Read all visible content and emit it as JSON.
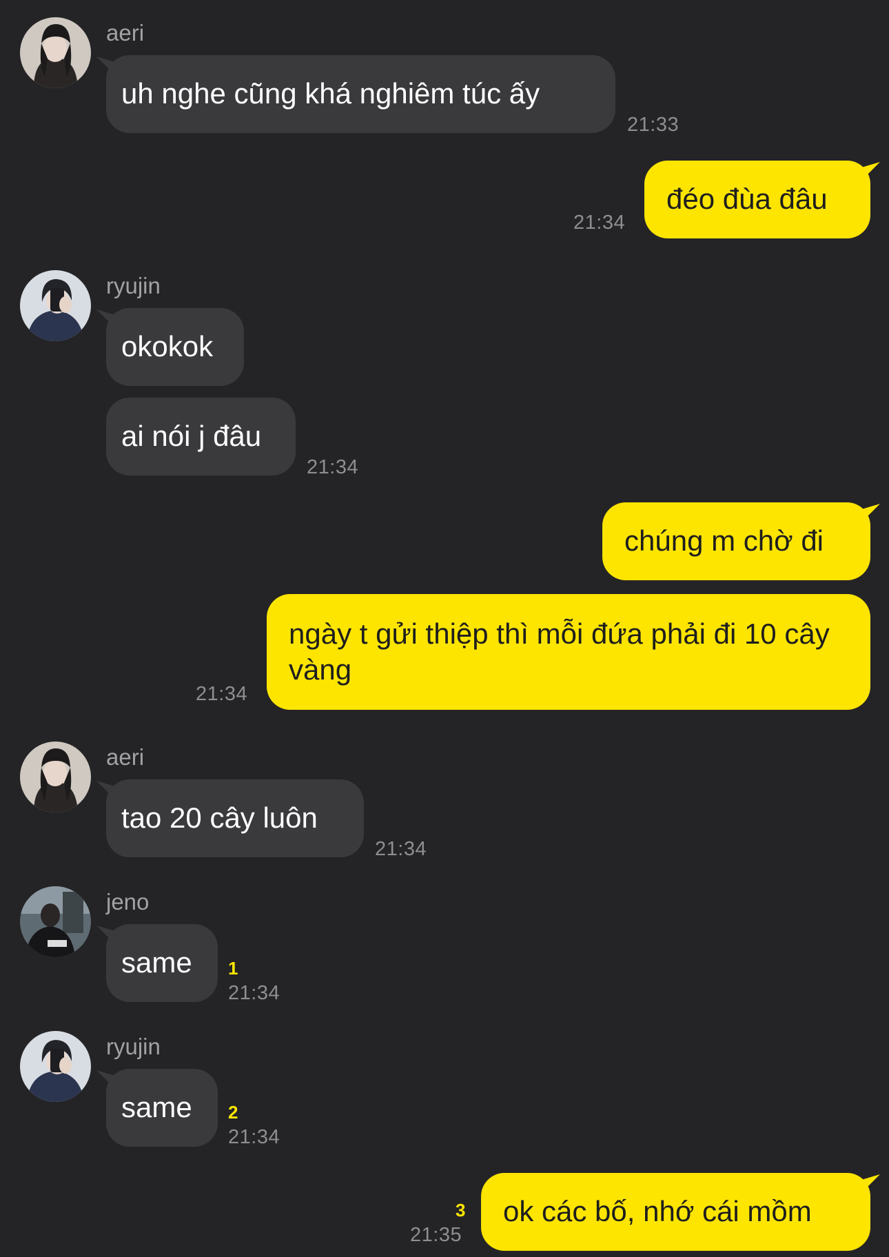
{
  "colors": {
    "background": "#242426",
    "incoming_bubble": "#3a3a3d",
    "outgoing_bubble": "#fee500",
    "unread_count": "#fee500",
    "timestamp": "#8e8e93",
    "sender_name": "#a2a2a6"
  },
  "messages": [
    {
      "sender": "aeri",
      "text": "uh nghe cũng khá nghiêm túc ấy",
      "time": "21:33"
    },
    {
      "text": "đéo đùa đâu",
      "time": "21:34"
    },
    {
      "sender": "ryujin",
      "text": "okokok"
    },
    {
      "text": "ai nói j đâu",
      "time": "21:34"
    },
    {
      "text": "chúng m chờ đi"
    },
    {
      "text": "ngày t gửi thiệp thì mỗi đứa phải đi 10 cây vàng",
      "time": "21:34"
    },
    {
      "sender": "aeri",
      "text": "tao 20 cây luôn",
      "time": "21:34"
    },
    {
      "sender": "jeno",
      "text": "same",
      "unread": "1",
      "time": "21:34"
    },
    {
      "sender": "ryujin",
      "text": "same",
      "unread": "2",
      "time": "21:34"
    },
    {
      "text": "ok các bố, nhớ cái mồm",
      "unread": "3",
      "time": "21:35"
    }
  ]
}
